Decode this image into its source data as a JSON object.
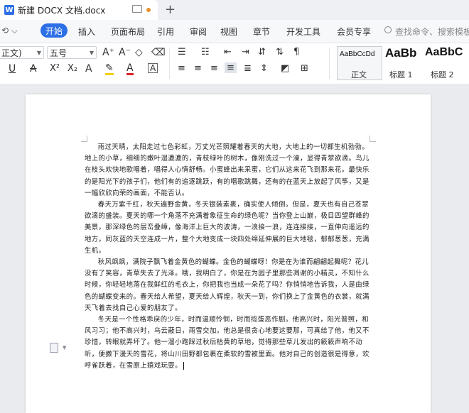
{
  "window": {
    "tab_title": "新建 DOCX 文档.docx",
    "doc_icon_letter": "W",
    "new_tab": "+"
  },
  "menubar": {
    "quick_access": "⟲ ⌵",
    "start": "开始",
    "items": [
      "插入",
      "页面布局",
      "引用",
      "审阅",
      "视图",
      "章节",
      "开发工具",
      "会员专享"
    ],
    "search_placeholder": "查找命令、搜索模板"
  },
  "toolbar": {
    "font_name": "正文)",
    "font_size": "五号",
    "grow_font": "A⁺",
    "shrink_font": "A⁻",
    "clear_format": "◇",
    "underline": "U",
    "strike": "A",
    "superscript": "X²",
    "subscript": "X₂",
    "text_effect": "A",
    "highlight": "✎",
    "font_color": "A",
    "char_border": "A",
    "styles": [
      {
        "preview": "AaBbCcDd",
        "name": "正文"
      },
      {
        "preview": "AaBb",
        "name": "标题 1"
      },
      {
        "preview": "AaBbC",
        "name": "标题 2"
      }
    ]
  },
  "document": {
    "paragraphs": [
      "雨过天晴，太阳走过七色彩虹，万丈光芒照耀着春天的大地，大地上的一切都生机勃勃。地上的小草，细细的嫩叶湿漉漉的，青枝绿叶的树木，像刚洗过一个澡，显得青翠欲滴。鸟儿在枝头欢快地歌唱着，唱得人心情舒畅。小蜜蜂出来采蜜，它们从这来花飞到那来花。最快乐的是阳光下的孩子们，他们有的追逐跳跃，有的唱歌跳舞，还有的在蓝天上放起了风筝，又是一幅欣欣向荣的画面，不能否认。",
      "春天万紫千红，秋天遍野金黄，冬天银装素裹，确实使人倾倒。但是，夏天也有自己苍翠欲滴的盛装。夏天的哪一个角落不充满着象征生命的绿色呢？当你登上山巅，极目四望群峰的美景，那深绿色的层峦叠嶂，像海洋上巨大的波涛，一浪接一浪，连连接接，一直伸向遥远的地方，同灰蓝的天空连成一片，整个大地变成一块四处绵延伸展的巨大地毯，郁郁葱葱，充满生机。",
      "秋风飒飒，满院子飘飞着金黄色的蝴蝶。金色的蝴蝶呀！你是在为谁而翩翩起舞呢？花儿没有了笑容，青草失去了光泽。哦，我明白了，你是在为园子里那些凋谢的小精灵，不知什么时候，你轻轻地落在我鲜红的毛衣上，你把我也当成一朵花了吗？你悄悄地告诉我，人是由绿色的蝴蝶变来的。春天给人希望，夏天给人辉煌，秋天一到，你们换上了金黄色的衣裳，就满天飞着去找自己心爱的朋友了。",
      "冬天是一个性格乖戾的少年，时而温顺怜悯，时而捣蛋恶作剧。他高兴时，阳光普照，和风习习；他不高兴时，乌云蔽日，雨雪交加。他总是很贪心地要这要那，可真给了他，他又不珍惜，转眼就弄坏了。他一溜小跑踩过秋后枯黄的草地，觉得那些草儿发出的簌簌声响不动听，便撒下漫天的雪花，将山川田野都包裹在柔软的雪被里面。他对自己的创造很是得意，欢呼雀跃着，在雪原上嬉戏玩耍。"
    ]
  }
}
